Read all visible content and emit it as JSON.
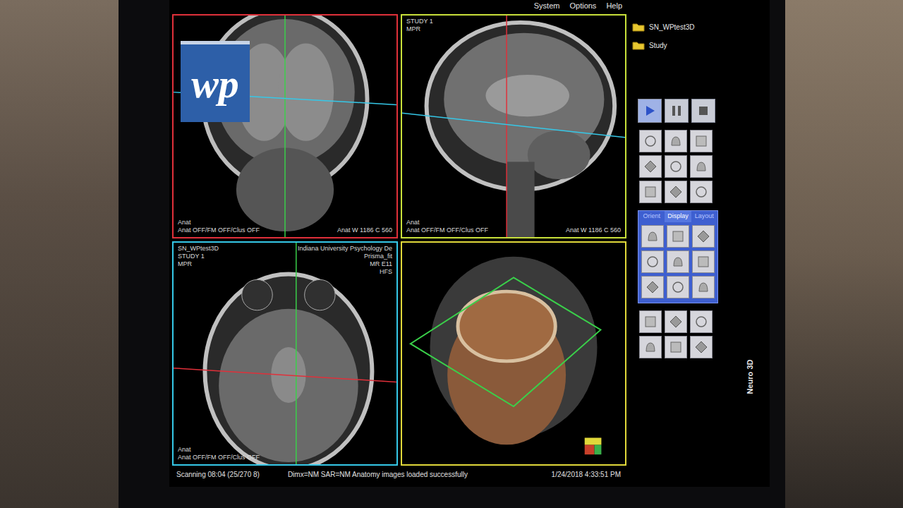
{
  "watermark": {
    "text": "wp"
  },
  "menu": [
    "System",
    "Options",
    "Help"
  ],
  "folders": [
    {
      "label": "SN_WPtest3D"
    },
    {
      "label": "Study"
    }
  ],
  "playback": [
    {
      "name": "play",
      "selected": true
    },
    {
      "name": "pause",
      "selected": false
    },
    {
      "name": "stop",
      "selected": false
    }
  ],
  "display_tabs": [
    {
      "label": "Orient",
      "selected": false
    },
    {
      "label": "Display",
      "selected": true
    },
    {
      "label": "Layout",
      "selected": false
    }
  ],
  "side_label": "Neuro 3D",
  "viewports": [
    {
      "kind": "coronal",
      "color": "#e0303a",
      "header_left": [],
      "header_right": [],
      "footer_left": [
        "Anat",
        "Anat OFF/FM OFF/Clus OFF"
      ],
      "footer_right": [
        "Anat W 1186 C 560"
      ]
    },
    {
      "kind": "sagittal",
      "color": "#c8e03a",
      "header_left": [
        "STUDY 1",
        "MPR"
      ],
      "header_right": [],
      "footer_left": [
        "Anat",
        "Anat OFF/FM OFF/Clus OFF"
      ],
      "footer_right": [
        "Anat W 1186 C 560"
      ]
    },
    {
      "kind": "axial",
      "color": "#35c8e8",
      "header_left": [
        "SN_WPtest3D",
        "STUDY 1",
        "MPR"
      ],
      "header_right": [
        "Indiana University Psychology De",
        "Prisma_fit",
        "MR E11",
        "HFS"
      ],
      "footer_left": [
        "Anat",
        "Anat OFF/FM OFF/Clus OFF"
      ],
      "footer_right": []
    },
    {
      "kind": "3d",
      "color": "#e0d83a",
      "header_left": [],
      "header_right": [],
      "footer_left": [],
      "footer_right": []
    }
  ],
  "status_bar": {
    "progress": "Scanning 08:04 (25/270 8)",
    "message": "Dimx=NM SAR=NM Anatomy images loaded successfully",
    "time": "1/24/2018 4:33:51 PM"
  }
}
